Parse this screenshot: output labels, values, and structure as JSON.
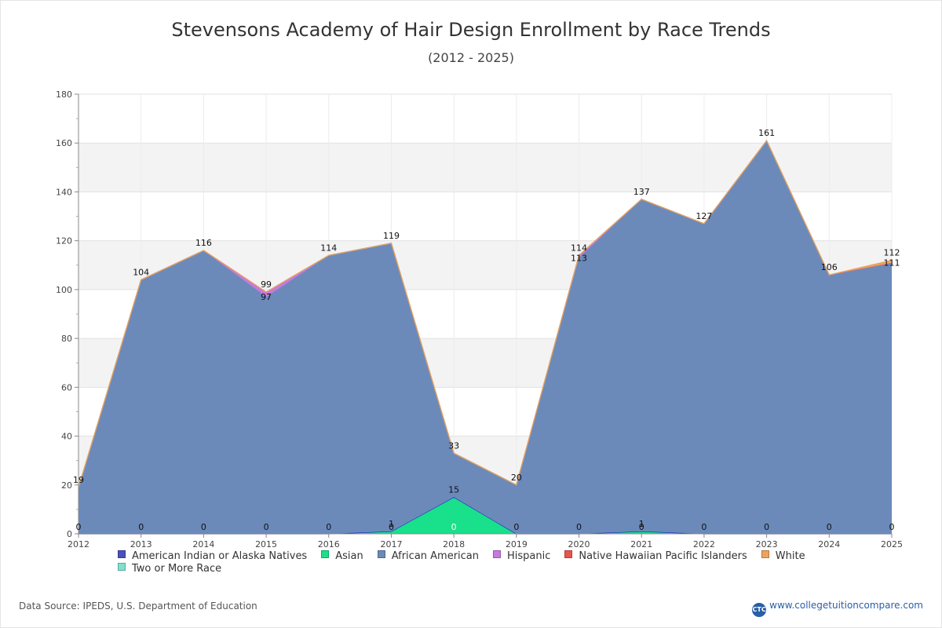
{
  "title": "Stevensons Academy of Hair Design Enrollment by Race Trends",
  "subtitle": "(2012 - 2025)",
  "source": "Data Source: IPEDS, U.S. Department of Education",
  "brand": {
    "logo_text": "CTC",
    "text": "www.collegetuitioncompare.com"
  },
  "chart_data": {
    "type": "area",
    "stacked": true,
    "title": "Stevensons Academy of Hair Design Enrollment by Race Trends",
    "subtitle": "(2012 - 2025)",
    "x": [
      "2012",
      "2013",
      "2014",
      "2015",
      "2016",
      "2017",
      "2018",
      "2019",
      "2020",
      "2021",
      "2022",
      "2023",
      "2024",
      "2025"
    ],
    "ylim": [
      0,
      180
    ],
    "yticks": [
      "0",
      "20",
      "40",
      "60",
      "80",
      "100",
      "120",
      "140",
      "160",
      "180"
    ],
    "grid": true,
    "legend_position": "bottom",
    "series": [
      {
        "name": "American Indian or Alaska Natives",
        "color": "#4b4fbf",
        "values": [
          0,
          0,
          0,
          0,
          0,
          0,
          0,
          0,
          0,
          0,
          0,
          0,
          0,
          0
        ]
      },
      {
        "name": "Asian",
        "color": "#19e08a",
        "values": [
          0,
          0,
          0,
          0,
          0,
          1,
          15,
          0,
          0,
          1,
          0,
          0,
          0,
          0
        ]
      },
      {
        "name": "African American",
        "color": "#6b8aba",
        "values": [
          19,
          104,
          116,
          97,
          114,
          118,
          18,
          20,
          113,
          136,
          127,
          161,
          106,
          111
        ]
      },
      {
        "name": "Hispanic",
        "color": "#c878e0",
        "values": [
          0,
          0,
          0,
          2,
          0,
          0,
          0,
          0,
          1,
          0,
          0,
          0,
          0,
          0
        ]
      },
      {
        "name": "Native Hawaiian Pacific Islanders",
        "color": "#e8554e",
        "values": [
          0,
          0,
          0,
          0,
          0,
          0,
          0,
          0,
          0,
          0,
          0,
          0,
          0,
          0
        ]
      },
      {
        "name": "White",
        "color": "#f0a35e",
        "values": [
          0,
          0,
          0,
          0,
          0,
          0,
          0,
          0,
          0,
          0,
          0,
          0,
          0,
          1
        ]
      },
      {
        "name": "Two or More Race",
        "color": "#7fe0d0",
        "values": [
          0,
          0,
          0,
          0,
          0,
          0,
          0,
          0,
          0,
          0,
          0,
          0,
          0,
          0
        ]
      }
    ],
    "data_labels": {
      "totals": [
        "19",
        "104",
        "116",
        "99",
        "114",
        "119",
        "33",
        "20",
        "114",
        "137",
        "127",
        "161",
        "106",
        "112"
      ],
      "secondary": [
        "",
        "",
        "",
        "97",
        "",
        "",
        "",
        "",
        "113",
        "",
        "",
        "",
        "",
        "111"
      ],
      "asian": [
        "0",
        "0",
        "0",
        "0",
        "0",
        "1",
        "15",
        "0",
        "0",
        "1",
        "0",
        "0",
        "0",
        "0"
      ],
      "asian_inner": [
        "",
        "",
        "",
        "",
        "",
        "0",
        "0",
        "",
        "",
        "0",
        "",
        "",
        "",
        ""
      ]
    }
  }
}
